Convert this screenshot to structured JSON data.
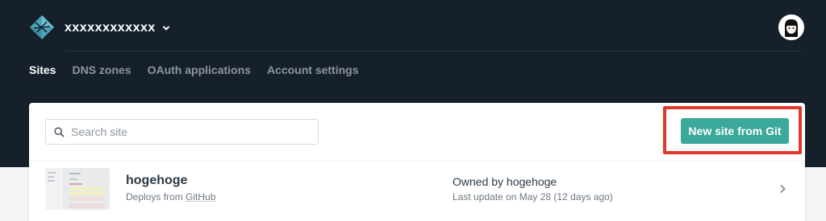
{
  "header": {
    "team_name": "xxxxxxxxxxxx",
    "nav": [
      {
        "label": "Sites",
        "active": true
      },
      {
        "label": "DNS zones",
        "active": false
      },
      {
        "label": "OAuth applications",
        "active": false
      },
      {
        "label": "Account settings",
        "active": false
      }
    ]
  },
  "toolbar": {
    "search_placeholder": "Search site",
    "new_site_label": "New site from Git"
  },
  "sites": [
    {
      "name": "hogehoge",
      "deploy_prefix": "Deploys from ",
      "deploy_source": "GitHub",
      "owner": "Owned by hogehoge",
      "last_update": "Last update on May 28 (12 days ago)"
    }
  ],
  "colors": {
    "header_bg": "#15202b",
    "accent": "#3aa89a",
    "highlight": "#e2382c"
  }
}
